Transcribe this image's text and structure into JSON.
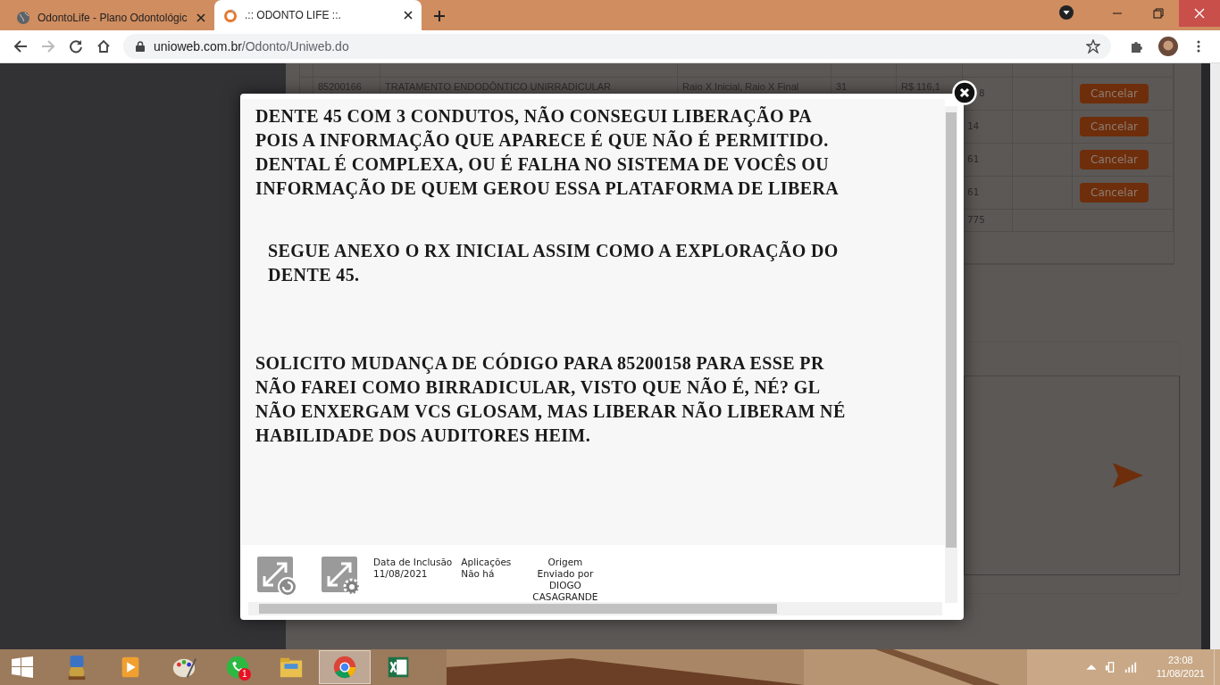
{
  "browser": {
    "tabs": [
      {
        "title": "OdontoLife - Plano Odontológic",
        "selected": false
      },
      {
        "title": ".:: ODONTO LIFE ::.",
        "selected": true
      }
    ],
    "address": {
      "host": "unioweb.com.br",
      "path": "/Odonto/Uniweb.do"
    }
  },
  "background_table": {
    "first_row": {
      "code": "85200166",
      "procedure": "TRATAMENTO ENDODÔNTICO UNIRRADICULAR",
      "detail": "Raio X Inicial, Raio X Final",
      "number": "31",
      "value": "R$ 116,1"
    },
    "rows": [
      {
        "quantity": "8",
        "action": "Cancelar"
      },
      {
        "quantity": "14",
        "action": "Cancelar"
      },
      {
        "quantity": "61",
        "action": "Cancelar"
      },
      {
        "quantity": "61",
        "action": "Cancelar"
      }
    ],
    "total": "775"
  },
  "modal": {
    "paragraphs": [
      {
        "indented": false,
        "lines": [
          "DENTE 45 COM 3 CONDUTOS, NÃO CONSEGUI LIBERAÇÃO PA",
          "POIS A INFORMAÇÃO QUE APARECE É QUE NÃO É PERMITIDO.",
          "DENTAL É COMPLEXA, OU É FALHA NO SISTEMA DE VOCÊS OU",
          "INFORMAÇÃO DE QUEM GEROU ESSA PLATAFORMA DE LIBERA"
        ]
      },
      {
        "indented": true,
        "lines": [
          "SEGUE ANEXO O RX INICIAL ASSIM COMO A EXPLORAÇÃO DO",
          "DENTE 45."
        ]
      },
      {
        "indented": false,
        "lines": [
          "SOLICITO MUDANÇA DE CÓDIGO PARA 85200158 PARA ESSE PR",
          "NÃO FAREI COMO BIRRADICULAR, VISTO QUE NÃO É, NÉ? GL",
          "NÃO ENXERGAM VCS GLOSAM, MAS LIBERAR NÃO LIBERAM NÉ",
          "HABILIDADE DOS AUDITORES HEIM."
        ]
      }
    ],
    "info": [
      {
        "label": "Data de Inclusão",
        "lines": [
          "11/08/2021"
        ]
      },
      {
        "label": "Aplicações",
        "lines": [
          "Não há"
        ]
      },
      {
        "label": "Origem",
        "lines": [
          "Enviado por",
          "DIOGO",
          "CASAGRANDE"
        ]
      }
    ]
  },
  "taskbar": {
    "apps": [
      {
        "selected": false
      },
      {
        "selected": false
      },
      {
        "selected": false
      },
      {
        "selected": false,
        "badge": "1"
      },
      {
        "selected": false
      },
      {
        "selected": true
      },
      {
        "selected": false
      }
    ],
    "time": "23:08",
    "date": "11/08/2021"
  }
}
